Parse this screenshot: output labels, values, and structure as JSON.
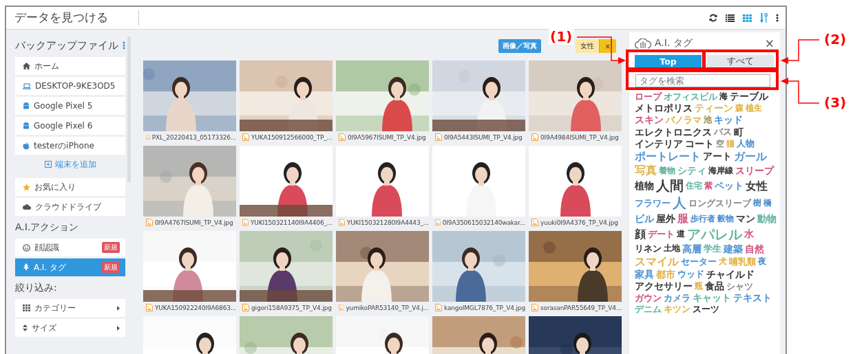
{
  "window": {
    "title": "データを見つける"
  },
  "toolbar": {
    "view_modes": [
      {
        "kind": "list",
        "selected": false
      },
      {
        "kind": "grid",
        "selected": true
      }
    ]
  },
  "sidebar": {
    "header": "バックアップファイル",
    "devices": [
      {
        "label": "ホーム"
      },
      {
        "label": "DESKTOP-9KE3OD5"
      },
      {
        "label": "Google Pixel 5"
      },
      {
        "label": "Google Pixel 6"
      },
      {
        "label": "testerのiPhone"
      }
    ],
    "add_device": "端末を追加",
    "places": [
      {
        "label": "お気に入り"
      },
      {
        "label": "クラウドドライブ"
      }
    ],
    "ai_header": "A.I.アクション",
    "ai_actions": [
      {
        "label": "顔認識",
        "badge": "新規",
        "selected": false
      },
      {
        "label": "A.I. タグ",
        "badge": "新規",
        "selected": true
      }
    ],
    "filter_header": "絞り込み:",
    "filters": [
      {
        "label": "カテゴリー"
      },
      {
        "label": "サイズ"
      }
    ]
  },
  "filter_bar": {
    "type_button": "画像／写真",
    "chip": "女性",
    "chip_close": "×"
  },
  "photos": [
    {
      "kind": "picture",
      "caption": "PXL_20220413_05173326..."
    },
    {
      "kind": "picture",
      "caption": "YUKA150912566000_TP_..."
    },
    {
      "kind": "picture",
      "caption": "0I9A5967ISUMI_TP_V4.jpg"
    },
    {
      "kind": "picture",
      "caption": "0I9A5443ISUMI_TP_V4.jpg"
    },
    {
      "kind": "picture",
      "caption": "0I9A4984ISUMI_TP_V4.jpg"
    },
    {
      "kind": "picture",
      "caption": "0I9A4767ISUMI_TP_V4.jpg"
    },
    {
      "kind": "picture",
      "caption": "YUKI150321140I9A4406_..."
    },
    {
      "kind": "picture",
      "caption": "YUKI150321280I9A4443_..."
    },
    {
      "kind": "picture",
      "caption": "0I9A350615032140wakar..."
    },
    {
      "kind": "picture",
      "caption": "yuuki0I9A4376_TP_V4.jpg"
    },
    {
      "kind": "picture",
      "caption": "YUKA150922240I9A6863..."
    },
    {
      "kind": "picture",
      "caption": "gigori158A9375_TP_V4.jpg"
    },
    {
      "kind": "picture",
      "caption": "yumikoPAR53140_TP_V4.j..."
    },
    {
      "kind": "picture",
      "caption": "kangoIMGL7876_TP_V4.jpg"
    },
    {
      "kind": "picture",
      "caption": "sorasanPAR55649_TP_V4..."
    },
    {
      "kind": "picture"
    },
    {
      "kind": "picture"
    },
    {
      "kind": "picture"
    },
    {
      "kind": "picture"
    },
    {
      "kind": "picture"
    }
  ],
  "tag_panel": {
    "title": "A.I. タグ",
    "close": "×",
    "tabs": [
      {
        "label": "Top",
        "selected": true
      },
      {
        "label": "すべて",
        "selected": false
      }
    ],
    "search": {
      "placeholder": "タグを検索"
    },
    "tags": [
      {
        "text": "ロープ",
        "kind": "s",
        "color": "#d0507a"
      },
      {
        "text": "オフィスビル",
        "kind": "s",
        "color": "#5fb3a0"
      },
      {
        "text": "海",
        "kind": "xs",
        "color": "#333333"
      },
      {
        "text": "テーブル",
        "kind": "m",
        "color": "#333333"
      },
      {
        "text": "メトロポリス",
        "kind": "m",
        "color": "#333333"
      },
      {
        "text": "ティーン",
        "kind": "m",
        "color": "#e0b040"
      },
      {
        "text": "森",
        "kind": "xs",
        "color": "#e0b040"
      },
      {
        "text": "植生",
        "kind": "xs",
        "color": "#e0b040"
      },
      {
        "text": "スキン",
        "kind": "m",
        "color": "#d0507a"
      },
      {
        "text": "パノラマ",
        "kind": "s",
        "color": "#e0b040"
      },
      {
        "text": "池",
        "kind": "xs",
        "color": "#9a8a50"
      },
      {
        "text": "キッド",
        "kind": "m",
        "color": "#4a90d0"
      },
      {
        "text": "エレクトロニクス",
        "kind": "m",
        "color": "#333333"
      },
      {
        "text": "バス",
        "kind": "s",
        "color": "#888888"
      },
      {
        "text": "町",
        "kind": "m",
        "color": "#333333"
      },
      {
        "text": "インテリア",
        "kind": "m",
        "color": "#333333"
      },
      {
        "text": "コート",
        "kind": "m",
        "color": "#333333"
      },
      {
        "text": "空",
        "kind": "xs",
        "color": "#888888"
      },
      {
        "text": "猫",
        "kind": "xs",
        "color": "#e0b040"
      },
      {
        "text": "人物",
        "kind": "s",
        "color": "#4a90d0"
      },
      {
        "text": "ポートレート",
        "kind": "l",
        "color": "#4a90d0"
      },
      {
        "text": "アート",
        "kind": "m",
        "color": "#333333"
      },
      {
        "text": "ガール",
        "kind": "l",
        "color": "#4a90d0"
      },
      {
        "text": "写真",
        "kind": "l",
        "color": "#e0b040"
      },
      {
        "text": "着物",
        "kind": "xs",
        "color": "#5fb3a0"
      },
      {
        "text": "シティ",
        "kind": "m",
        "color": "#5fb3a0"
      },
      {
        "text": "海岸線",
        "kind": "xs",
        "color": "#333333"
      },
      {
        "text": "スリープ",
        "kind": "m",
        "color": "#d0507a"
      },
      {
        "text": "植物",
        "kind": "m",
        "color": "#333333"
      },
      {
        "text": "人間",
        "kind": "xl",
        "color": "#333333"
      },
      {
        "text": "住宅",
        "kind": "xs",
        "color": "#5fb3a0"
      },
      {
        "text": "紫",
        "kind": "xs",
        "color": "#d0507a"
      },
      {
        "text": "ペット",
        "kind": "m",
        "color": "#4a90d0"
      },
      {
        "text": "女性",
        "kind": "l",
        "color": "#333333"
      },
      {
        "text": "フラワー",
        "kind": "s",
        "color": "#4a90d0"
      },
      {
        "text": "人",
        "kind": "xl",
        "color": "#4a90d0"
      },
      {
        "text": "ロングスリーブ",
        "kind": "s",
        "color": "#888888"
      },
      {
        "text": "樹",
        "kind": "xs",
        "color": "#4a90d0"
      },
      {
        "text": "橋",
        "kind": "xs",
        "color": "#4a90d0"
      },
      {
        "text": "ビル",
        "kind": "m",
        "color": "#4a90d0"
      },
      {
        "text": "屋外",
        "kind": "m",
        "color": "#333333"
      },
      {
        "text": "服",
        "kind": "l",
        "color": "#d0507a"
      },
      {
        "text": "歩行者",
        "kind": "xs",
        "color": "#4a90d0"
      },
      {
        "text": "穀物",
        "kind": "xs",
        "color": "#4a90d0"
      },
      {
        "text": "マン",
        "kind": "m",
        "color": "#333333"
      },
      {
        "text": "動物",
        "kind": "m",
        "color": "#5fb3a0"
      },
      {
        "text": "顔",
        "kind": "l",
        "color": "#333333"
      },
      {
        "text": "デート",
        "kind": "s",
        "color": "#d0507a"
      },
      {
        "text": "道",
        "kind": "xs",
        "color": "#333333"
      },
      {
        "text": "アパレル",
        "kind": "xl",
        "color": "#5fb3a0"
      },
      {
        "text": "水",
        "kind": "m",
        "color": "#d0507a"
      },
      {
        "text": "リネン",
        "kind": "s",
        "color": "#333333"
      },
      {
        "text": "土地",
        "kind": "xs",
        "color": "#333333"
      },
      {
        "text": "高層",
        "kind": "m",
        "color": "#4a90d0"
      },
      {
        "text": "学生",
        "kind": "s",
        "color": "#5fb3a0"
      },
      {
        "text": "建築",
        "kind": "m",
        "color": "#4a90d0"
      },
      {
        "text": "自然",
        "kind": "m",
        "color": "#d0507a"
      },
      {
        "text": "スマイル",
        "kind": "l",
        "color": "#e0b040"
      },
      {
        "text": "セーター",
        "kind": "s",
        "color": "#4a90d0"
      },
      {
        "text": "犬",
        "kind": "xs",
        "color": "#e0b040"
      },
      {
        "text": "哺乳類",
        "kind": "s",
        "color": "#e0b040"
      },
      {
        "text": "夜",
        "kind": "xs",
        "color": "#4a90d0"
      },
      {
        "text": "家具",
        "kind": "m",
        "color": "#4a90d0"
      },
      {
        "text": "都市",
        "kind": "m",
        "color": "#e0b040"
      },
      {
        "text": "ウッド",
        "kind": "s",
        "color": "#4a90d0"
      },
      {
        "text": "チャイルド",
        "kind": "m",
        "color": "#333333"
      },
      {
        "text": "アクセサリー",
        "kind": "m",
        "color": "#333333"
      },
      {
        "text": "瓶",
        "kind": "xs",
        "color": "#e0b040"
      },
      {
        "text": "食品",
        "kind": "m",
        "color": "#333333"
      },
      {
        "text": "シャツ",
        "kind": "s",
        "color": "#888888"
      },
      {
        "text": "ガウン",
        "kind": "s",
        "color": "#d0507a"
      },
      {
        "text": "カメラ",
        "kind": "s",
        "color": "#4a90d0"
      },
      {
        "text": "キャット",
        "kind": "m",
        "color": "#5fb3a0"
      },
      {
        "text": "テキスト",
        "kind": "m",
        "color": "#4a90d0"
      },
      {
        "text": "デニム",
        "kind": "s",
        "color": "#5fb3a0"
      },
      {
        "text": "キツン",
        "kind": "s",
        "color": "#e0b040"
      },
      {
        "text": "スーツ",
        "kind": "s",
        "color": "#333333"
      }
    ]
  },
  "annotations": [
    {
      "label": "(1)"
    },
    {
      "label": "(2)"
    },
    {
      "label": "(3)"
    }
  ]
}
